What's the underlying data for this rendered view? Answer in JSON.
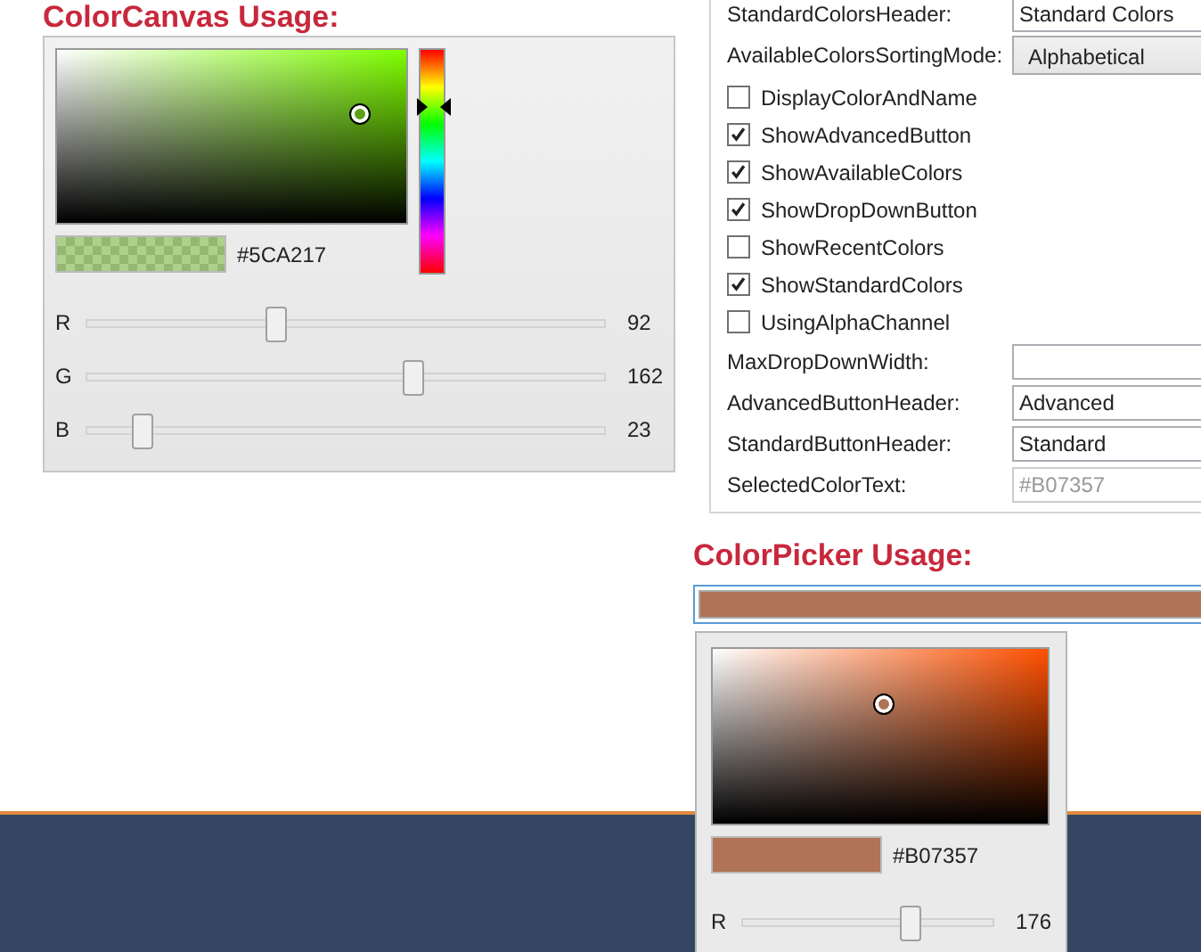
{
  "color_canvas": {
    "title": "ColorCanvas Usage:",
    "hex": "#5CA217",
    "sliders": [
      {
        "label": "R",
        "value": "92",
        "level": 0.36
      },
      {
        "label": "G",
        "value": "162",
        "level": 0.635
      },
      {
        "label": "B",
        "value": "23",
        "level": 0.09
      }
    ]
  },
  "properties": [
    {
      "kind": "field",
      "label": "StandardColorsHeader:",
      "value": "Standard Colors",
      "disabled": false
    },
    {
      "kind": "dropdown",
      "label": "AvailableColorsSortingMode:",
      "value": "Alphabetical"
    },
    {
      "kind": "checkbox",
      "label": "DisplayColorAndName",
      "checked": false
    },
    {
      "kind": "checkbox",
      "label": "ShowAdvancedButton",
      "checked": true
    },
    {
      "kind": "checkbox",
      "label": "ShowAvailableColors",
      "checked": true
    },
    {
      "kind": "checkbox",
      "label": "ShowDropDownButton",
      "checked": true
    },
    {
      "kind": "checkbox",
      "label": "ShowRecentColors",
      "checked": false
    },
    {
      "kind": "checkbox",
      "label": "ShowStandardColors",
      "checked": true
    },
    {
      "kind": "checkbox",
      "label": "UsingAlphaChannel",
      "checked": false
    },
    {
      "kind": "field",
      "label": "MaxDropDownWidth:",
      "disabled": false
    },
    {
      "kind": "field",
      "label": "AdvancedButtonHeader:",
      "value": "Advanced",
      "disabled": false
    },
    {
      "kind": "field",
      "label": "StandardButtonHeader:",
      "value": "Standard",
      "disabled": false
    },
    {
      "kind": "field",
      "label": "SelectedColorText:",
      "value": "#B07357",
      "disabled": true
    }
  ],
  "color_picker": {
    "title": "ColorPicker Usage:",
    "hex": "#B07357",
    "sliders": [
      {
        "label": "R",
        "value": "176",
        "level": 0.69
      }
    ]
  }
}
